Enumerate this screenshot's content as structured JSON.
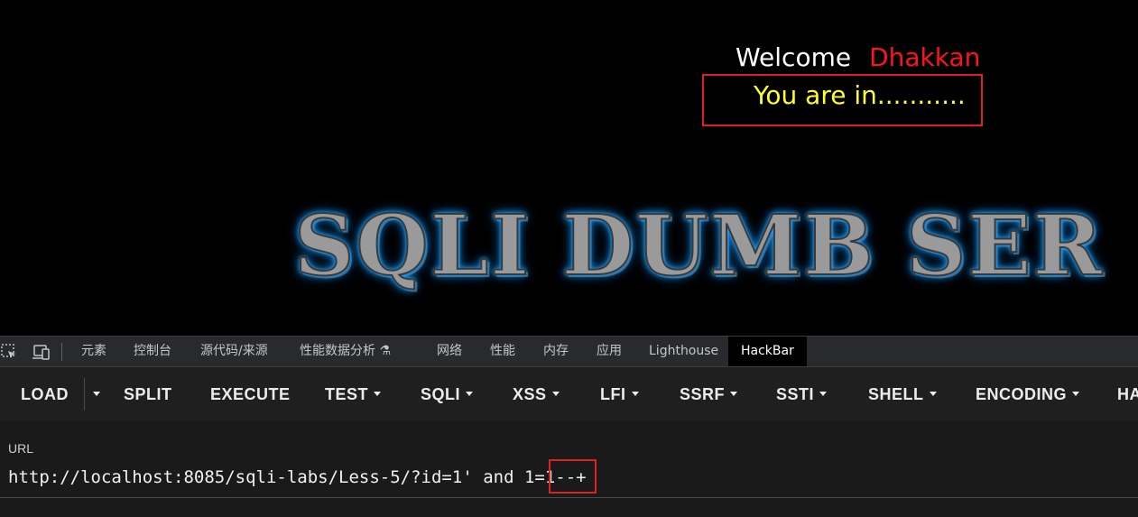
{
  "page": {
    "welcome_label": "Welcome",
    "user_name": "Dhakkan",
    "message": "You are in...........",
    "banner_text": "SQLI DUMB SER"
  },
  "devtools": {
    "tabs": [
      {
        "label": "元素"
      },
      {
        "label": "控制台"
      },
      {
        "label": "源代码/来源"
      },
      {
        "label": "性能数据分析 ⚗"
      },
      {
        "label": "网络"
      },
      {
        "label": "性能"
      },
      {
        "label": "内存"
      },
      {
        "label": "应用"
      },
      {
        "label": "Lighthouse"
      },
      {
        "label": "HackBar"
      }
    ],
    "active_tab": "HackBar",
    "icons": [
      "inspect-element-icon",
      "device-toolbar-icon"
    ]
  },
  "hackbar": {
    "buttons": [
      {
        "label": "LOAD"
      },
      {
        "label": "SPLIT"
      },
      {
        "label": "EXECUTE"
      },
      {
        "label": "TEST"
      },
      {
        "label": "SQLI"
      },
      {
        "label": "XSS"
      },
      {
        "label": "LFI"
      },
      {
        "label": "SSRF"
      },
      {
        "label": "SSTI"
      },
      {
        "label": "SHELL"
      },
      {
        "label": "ENCODING"
      },
      {
        "label": "HA"
      }
    ],
    "url_label": "URL",
    "url_value": "http://localhost:8085/sqli-labs/Less-5/?id=1' and 1=1--+"
  },
  "colors": {
    "page_bg": "#000000",
    "welcome": "#ffffff",
    "user_name": "#ff1414",
    "message": "#ffff22",
    "highlight_border": "#e02020",
    "banner_glow": "#1a9fff"
  }
}
